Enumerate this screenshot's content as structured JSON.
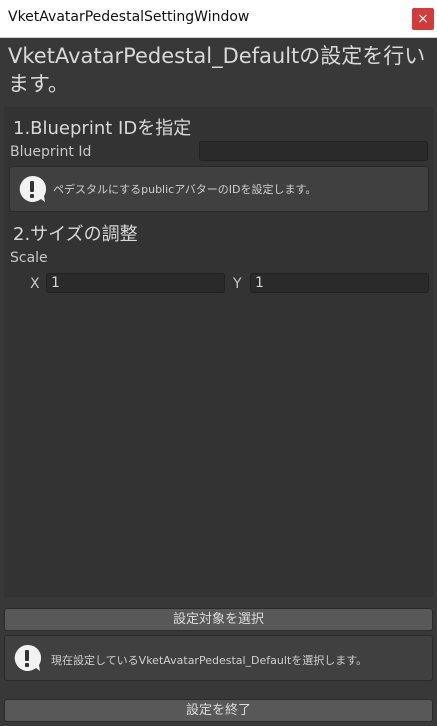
{
  "window": {
    "title": "VketAvatarPedestalSettingWindow",
    "close_label": "×"
  },
  "heading": "VketAvatarPedestal_Defaultの設定を行います。",
  "section1": {
    "title": "1.Blueprint IDを指定",
    "field_label": "Blueprint Id",
    "field_value": "",
    "help_text": "ペデスタルにするpublicアバターのIDを設定します。"
  },
  "section2": {
    "title": "2.サイズの調整",
    "scale_label": "Scale",
    "x_label": "X",
    "x_value": "1",
    "y_label": "Y",
    "y_value": "1"
  },
  "footer": {
    "select_button": "設定対象を選択",
    "help_text": "現在設定しているVketAvatarPedestal_Defaultを選択します。",
    "finish_button": "設定を終了"
  }
}
